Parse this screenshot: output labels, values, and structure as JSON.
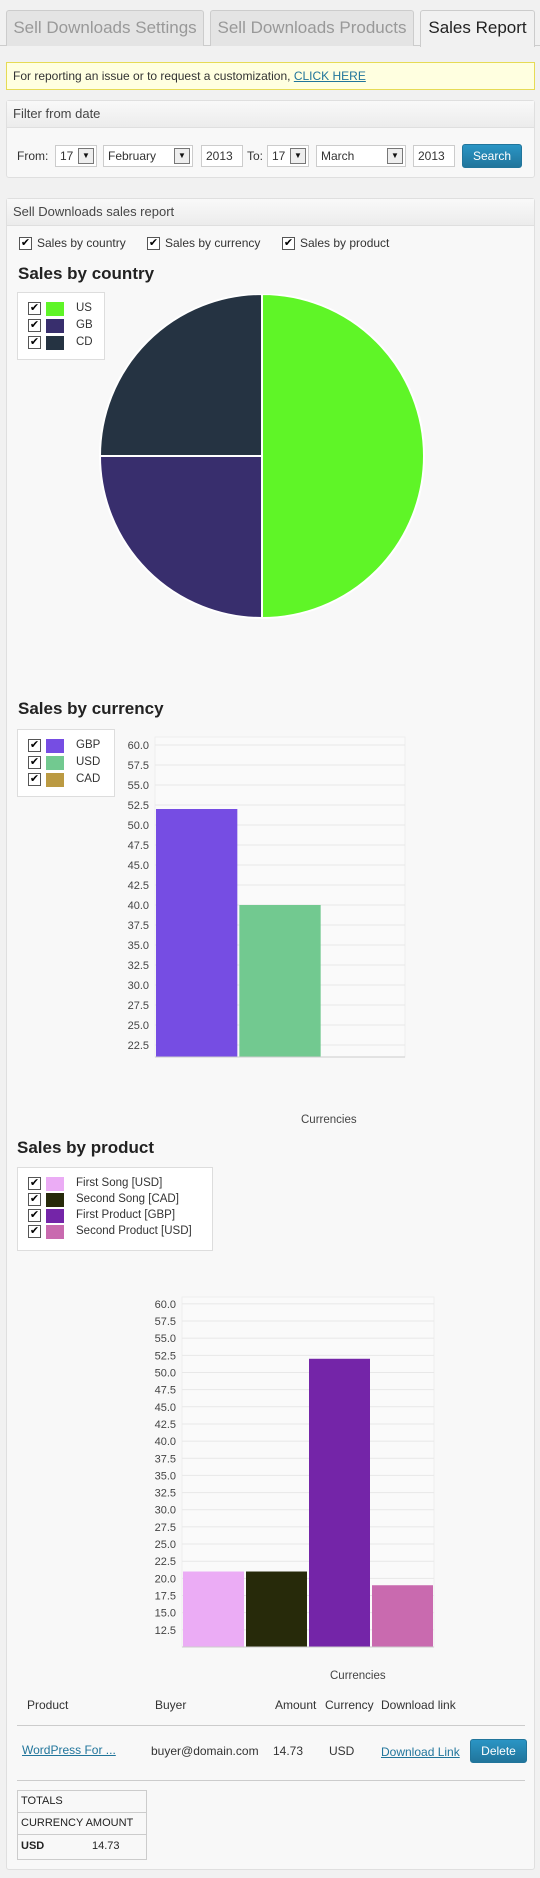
{
  "tabs": [
    {
      "label": "Sell Downloads Settings"
    },
    {
      "label": "Sell Downloads Products"
    },
    {
      "label": "Sales Report"
    }
  ],
  "notice": {
    "text": "For reporting an issue or to request a customization, ",
    "link": "CLICK HERE"
  },
  "filter": {
    "title": "Filter from date",
    "from_label": "From:",
    "from_day": "17",
    "from_month": "February",
    "from_year": "2013",
    "to_label": "To:",
    "to_day": "17",
    "to_month": "March",
    "to_year": "2013",
    "search_label": "Search"
  },
  "report": {
    "title": "Sell Downloads sales report",
    "toggles": [
      "Sales by country",
      "Sales by currency",
      "Sales by product"
    ],
    "country_title": "Sales by country",
    "currency_title": "Sales by currency",
    "product_title": "Sales by product",
    "currencies_label": "Currencies"
  },
  "colors": {
    "accent": "#21759b",
    "US": "#5ff527",
    "GB": "#382e6d",
    "CD": "#253342",
    "GBP": "#764de3",
    "USD": "#72c990",
    "CAD": "#bb9a42",
    "first_song": "#ebacf5",
    "second_song": "#272a0a",
    "first_product": "#7425a8",
    "second_product": "#c96aaf"
  },
  "chart_data": [
    {
      "type": "pie",
      "title": "Sales by country",
      "categories": [
        "US",
        "GB",
        "CD"
      ],
      "values": [
        50,
        25,
        25
      ],
      "legend": "top-left"
    },
    {
      "type": "bar",
      "title": "Sales by currency",
      "xlabel": "Currencies",
      "categories": [
        "GBP",
        "USD",
        "CAD"
      ],
      "values": [
        52.0,
        40.0,
        21.0
      ],
      "ylim": [
        21.0,
        61.0
      ],
      "yticks": [
        "22.5",
        "25.0",
        "27.5",
        "30.0",
        "32.5",
        "35.0",
        "37.5",
        "40.0",
        "42.5",
        "45.0",
        "47.5",
        "50.0",
        "52.5",
        "55.0",
        "57.5",
        "60.0"
      ],
      "grid": true,
      "legend": "top-left"
    },
    {
      "type": "bar",
      "title": "Sales by product",
      "xlabel": "Currencies",
      "categories": [
        "First Song [USD]",
        "Second Song [CAD]",
        "First Product [GBP]",
        "Second Product [USD]"
      ],
      "values": [
        21.0,
        21.0,
        52.0,
        19.0
      ],
      "ylim": [
        10.0,
        61.0
      ],
      "yticks": [
        "12.5",
        "15.0",
        "17.5",
        "20.0",
        "22.5",
        "25.0",
        "27.5",
        "30.0",
        "32.5",
        "35.0",
        "37.5",
        "40.0",
        "42.5",
        "45.0",
        "47.5",
        "50.0",
        "52.5",
        "55.0",
        "57.5",
        "60.0"
      ],
      "grid": true,
      "legend": "top-left"
    }
  ],
  "table": {
    "headers": [
      "Product",
      "Buyer",
      "Amount",
      "Currency",
      "Download link"
    ],
    "row": {
      "product": "WordPress For ...",
      "buyer": "buyer@domain.com",
      "amount": "14.73",
      "currency": "USD",
      "download": "Download Link",
      "delete": "Delete"
    }
  },
  "totals": {
    "title": "TOTALS",
    "header": "CURRENCY AMOUNT",
    "currency": "USD",
    "amount": "14.73"
  }
}
